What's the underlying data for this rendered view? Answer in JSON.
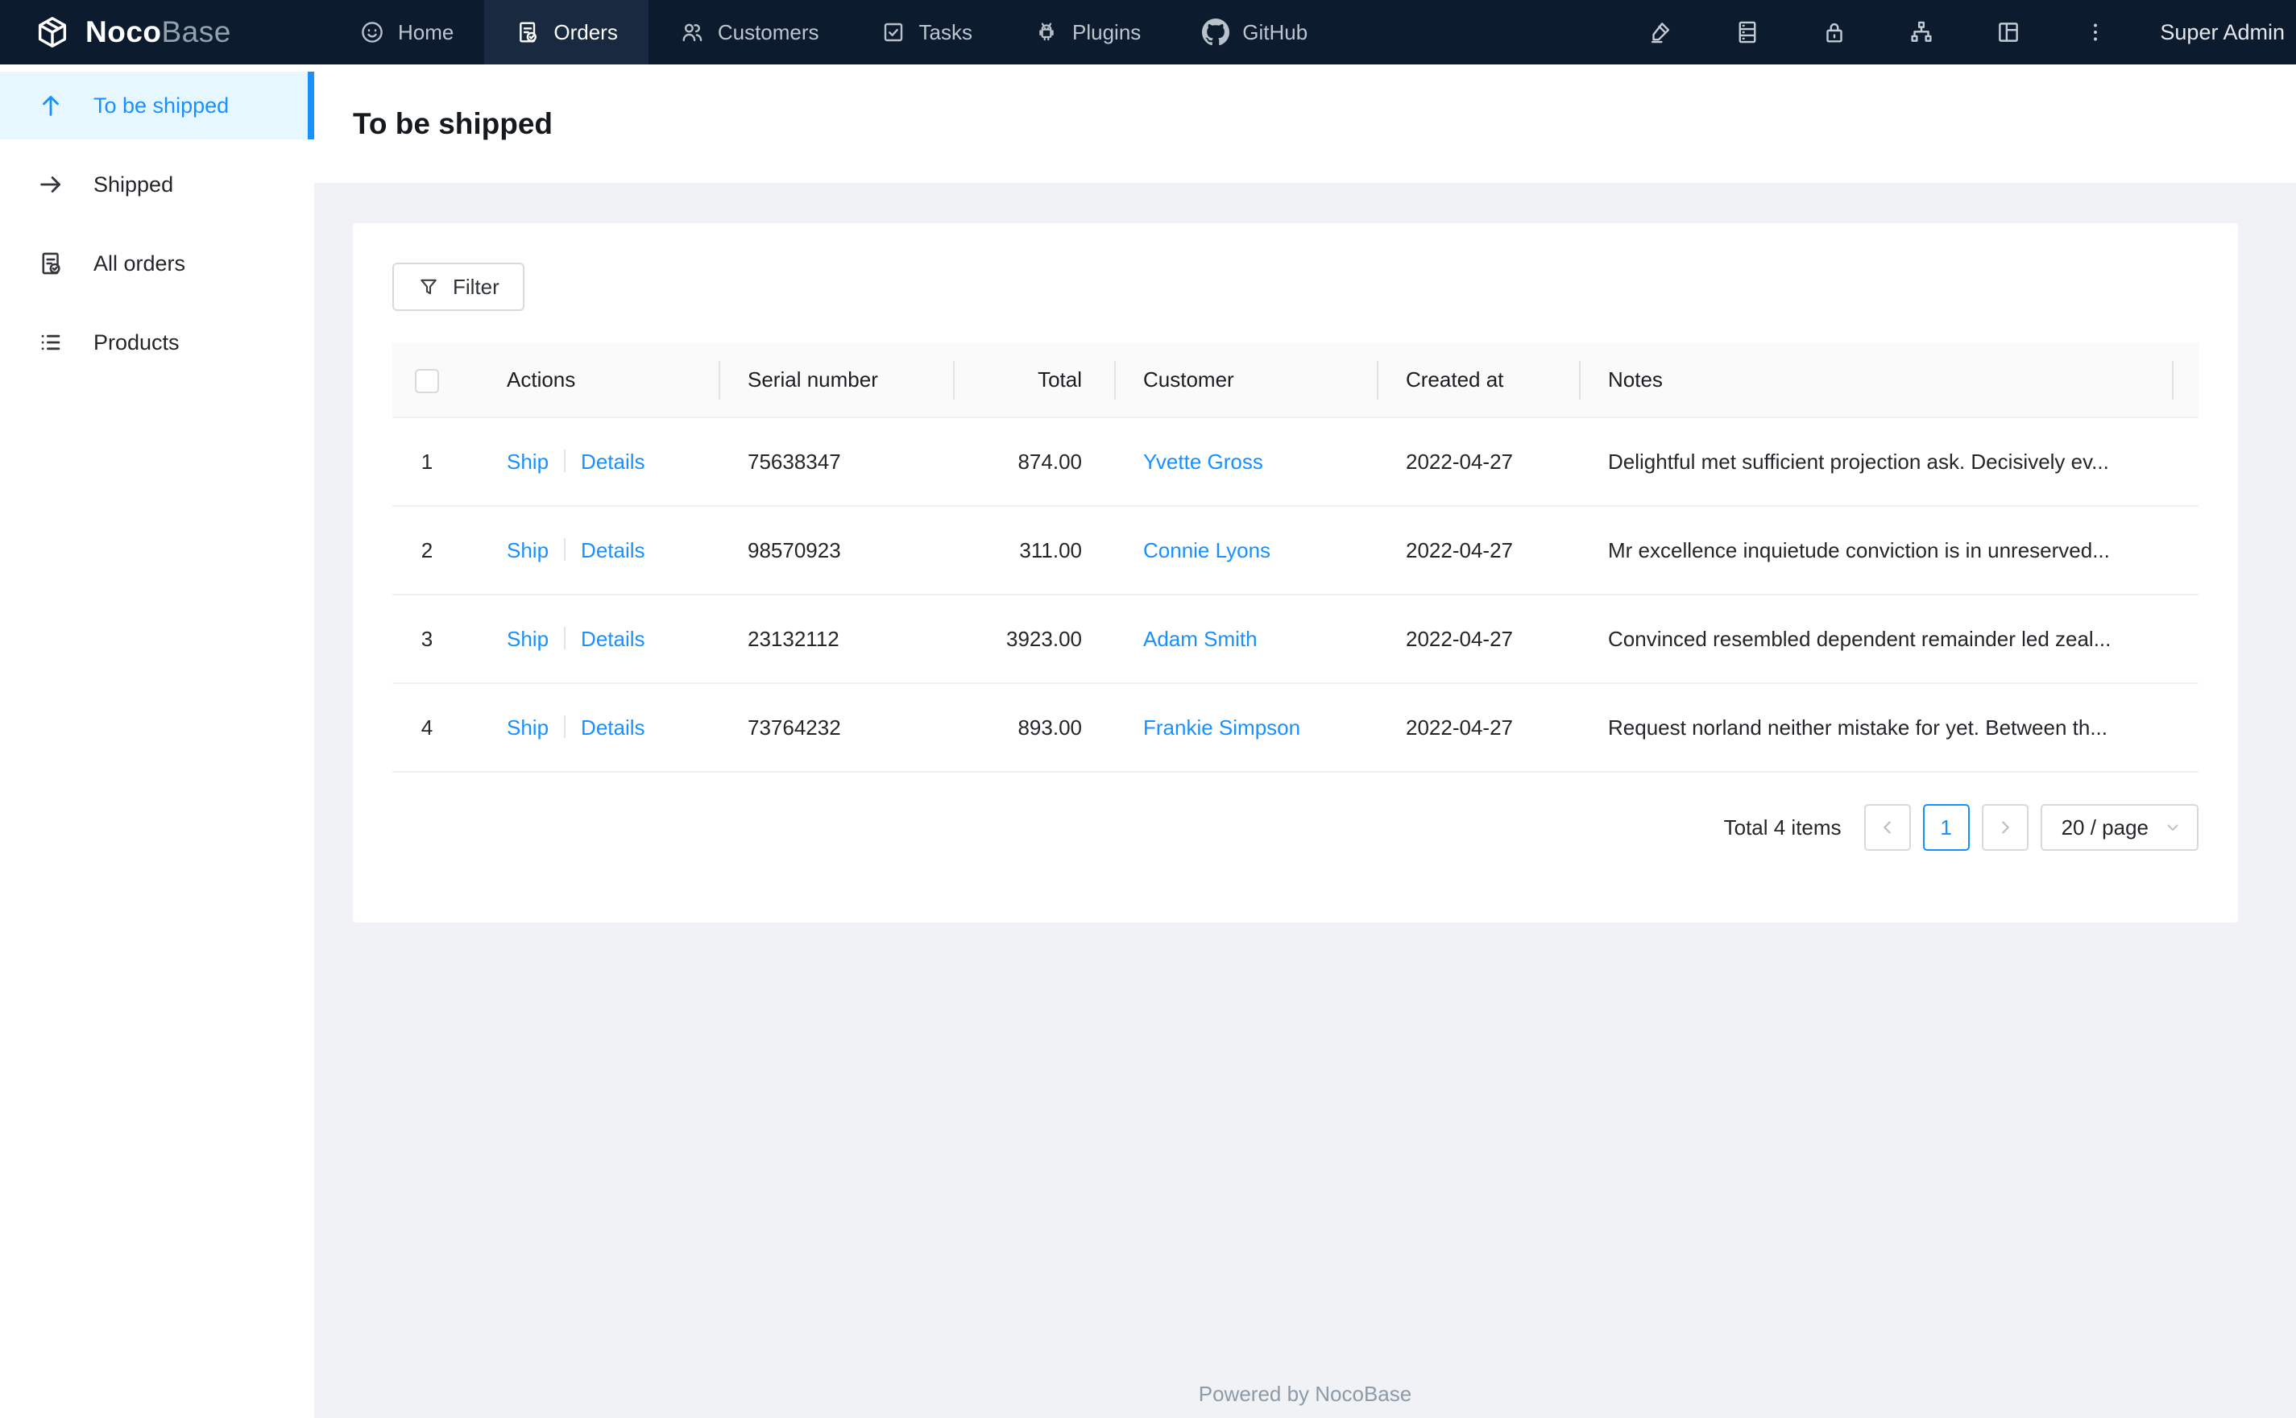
{
  "navbar": {
    "logo": {
      "noco": "Noco",
      "base": "Base"
    },
    "items": [
      {
        "label": "Home",
        "icon": "smiley-icon",
        "active": false
      },
      {
        "label": "Orders",
        "icon": "orders-icon",
        "active": true
      },
      {
        "label": "Customers",
        "icon": "customers-icon",
        "active": false
      },
      {
        "label": "Tasks",
        "icon": "tasks-icon",
        "active": false
      },
      {
        "label": "Plugins",
        "icon": "plugins-icon",
        "active": false
      },
      {
        "label": "GitHub",
        "icon": "github-icon",
        "active": false
      }
    ],
    "right_icons": [
      "highlighter-icon",
      "database-icon",
      "lock-icon",
      "org-chart-icon",
      "layout-icon",
      "more-icon"
    ],
    "user": "Super Admin"
  },
  "sidebar": {
    "items": [
      {
        "label": "To be shipped",
        "icon": "arrow-up-icon",
        "active": true
      },
      {
        "label": "Shipped",
        "icon": "arrow-right-icon",
        "active": false
      },
      {
        "label": "All orders",
        "icon": "orders-icon",
        "active": false
      },
      {
        "label": "Products",
        "icon": "list-icon",
        "active": false
      }
    ]
  },
  "page": {
    "title": "To be shipped"
  },
  "toolbar": {
    "filter_label": "Filter"
  },
  "table": {
    "columns": [
      "Actions",
      "Serial number",
      "Total",
      "Customer",
      "Created at",
      "Notes"
    ],
    "action_labels": {
      "ship": "Ship",
      "details": "Details"
    },
    "rows": [
      {
        "index": "1",
        "serial": "75638347",
        "total": "874.00",
        "customer": "Yvette Gross",
        "created_at": "2022-04-27",
        "notes": "Delightful met sufficient projection ask. Decisively ev..."
      },
      {
        "index": "2",
        "serial": "98570923",
        "total": "311.00",
        "customer": "Connie Lyons",
        "created_at": "2022-04-27",
        "notes": "Mr excellence inquietude conviction is in unreserved..."
      },
      {
        "index": "3",
        "serial": "23132112",
        "total": "3923.00",
        "customer": "Adam Smith",
        "created_at": "2022-04-27",
        "notes": "Convinced resembled dependent remainder led zeal..."
      },
      {
        "index": "4",
        "serial": "73764232",
        "total": "893.00",
        "customer": "Frankie Simpson",
        "created_at": "2022-04-27",
        "notes": "Request norland neither mistake for yet. Between th..."
      }
    ]
  },
  "pagination": {
    "total_text": "Total 4 items",
    "current_page": "1",
    "page_size": "20 / page"
  },
  "footer": {
    "text": "Powered by NocoBase"
  },
  "colors": {
    "accent": "#1890ff",
    "navbar_bg": "#0d1b2e",
    "navbar_active_bg": "#182940",
    "sidebar_active_bg": "#e6f7ff",
    "content_bg": "#f0f2f5"
  }
}
